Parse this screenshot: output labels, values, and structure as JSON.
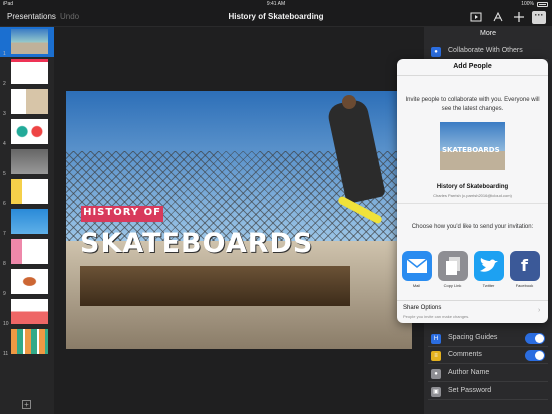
{
  "status": {
    "left": "iPad",
    "time": "9:41 AM",
    "battery": "100%"
  },
  "toolbar": {
    "presentations": "Presentations",
    "undo": "Undo",
    "title": "History of Skateboarding"
  },
  "navigator": {
    "slide_numbers": [
      "1",
      "2",
      "3",
      "4",
      "5",
      "6",
      "7",
      "8",
      "9",
      "10",
      "11"
    ]
  },
  "slide": {
    "banner": "HISTORY OF",
    "title": "SKATEBOARDS"
  },
  "more_panel": {
    "title": "More",
    "items": [
      {
        "label": "Collaborate With Others",
        "icon": "person-icon",
        "color": "#2b6de0"
      },
      {
        "label": "Spacing Guides",
        "icon": "guides-icon",
        "color": "#2b6de0",
        "toggle": true
      },
      {
        "label": "Comments",
        "icon": "comment-icon",
        "color": "#e5b21f",
        "toggle": true
      },
      {
        "label": "Author Name",
        "icon": "person-icon",
        "color": "#8e8e93"
      },
      {
        "label": "Set Password",
        "icon": "lock-icon",
        "color": "#8e8e93"
      }
    ]
  },
  "popover": {
    "title": "Add People",
    "intro": "Invite people to collaborate with you. Everyone will see the latest changes.",
    "doc_title": "History of Skateboarding",
    "owner": "Charles Parrish (c.parrish2016@icloud.com)",
    "choose": "Choose how you'd like to send your invitation:",
    "share_targets": [
      {
        "label": "Mail",
        "color": "#2a8cf0",
        "icon": "mail-icon"
      },
      {
        "label": "Copy Link",
        "color": "#8e8e93",
        "icon": "copy-icon"
      },
      {
        "label": "Twitter",
        "color": "#1da1f2",
        "icon": "twitter-icon"
      },
      {
        "label": "Facebook",
        "color": "#3b5998",
        "icon": "facebook-icon"
      }
    ],
    "share_options": "Share Options",
    "share_options_sub": "People you invite can make changes."
  }
}
